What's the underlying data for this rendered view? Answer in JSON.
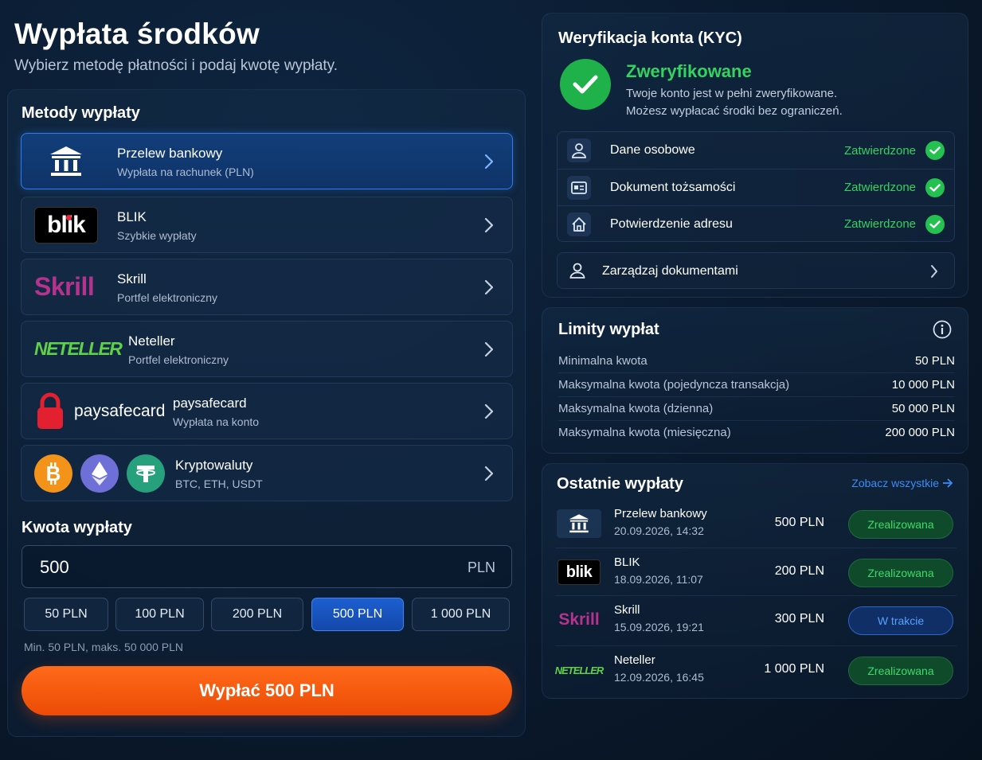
{
  "header": {
    "title": "Wypłata środków",
    "subtitle": "Wybierz metodę płatności i podaj kwotę wypłaty."
  },
  "methods": {
    "title": "Metody wypłaty",
    "items": [
      {
        "name": "Przelew bankowy",
        "desc": "Wypłata na rachunek (PLN)",
        "selected": true,
        "icon": "bank-icon"
      },
      {
        "name": "BLIK",
        "desc": "Szybkie wypłaty",
        "logo_text": "blik"
      },
      {
        "name": "Skrill",
        "desc": "Portfel elektroniczny",
        "logo_text": "Skrill"
      },
      {
        "name": "Neteller",
        "desc": "Portfel elektroniczny",
        "logo_text": "NETELLER"
      },
      {
        "name": "paysafecard",
        "desc": "Wypłata na konto",
        "logo_text": "paysafecard"
      },
      {
        "name": "Kryptowaluty",
        "desc": "BTC, ETH, USDT"
      }
    ]
  },
  "amount": {
    "title": "Kwota wypłaty",
    "value": "500",
    "currency": "PLN",
    "chips": [
      "50 PLN",
      "100 PLN",
      "200 PLN",
      "500 PLN",
      "1 000 PLN"
    ],
    "active_chip": "500 PLN",
    "hint": "Min. 50 PLN, maks. 50 000 PLN",
    "cta": "Wypłać 500 PLN"
  },
  "kyc": {
    "title": "Weryfikacja konta (KYC)",
    "status_title": "Zweryfikowane",
    "status_line1": "Twoje konto jest w pełni zweryfikowane.",
    "status_line2": "Możesz wypłacać środki bez ograniczeń.",
    "items": [
      {
        "label": "Dane osobowe",
        "status": "Zatwierdzone",
        "icon": "user-icon"
      },
      {
        "label": "Dokument tożsamości",
        "status": "Zatwierdzone",
        "icon": "id-card-icon"
      },
      {
        "label": "Potwierdzenie adresu",
        "status": "Zatwierdzone",
        "icon": "home-icon"
      }
    ],
    "manage": "Zarządzaj dokumentami"
  },
  "limits": {
    "title": "Limity wypłat",
    "rows": [
      {
        "label": "Minimalna kwota",
        "value": "50 PLN"
      },
      {
        "label": "Maksymalna kwota (pojedyncza transakcja)",
        "value": "10 000 PLN"
      },
      {
        "label": "Maksymalna kwota (dzienna)",
        "value": "50 000 PLN"
      },
      {
        "label": "Maksymalna kwota (miesięczna)",
        "value": "200 000 PLN"
      }
    ]
  },
  "recent": {
    "title": "Ostatnie wypłaty",
    "see_all": "Zobacz wszystkie",
    "rows": [
      {
        "method": "Przelew bankowy",
        "date": "20.09.2026, 14:32",
        "amount": "500 PLN",
        "status": "Zrealizowana",
        "state": "done",
        "logo_text": ""
      },
      {
        "method": "BLIK",
        "date": "18.09.2026, 11:07",
        "amount": "200 PLN",
        "status": "Zrealizowana",
        "state": "done",
        "logo_text": "blik"
      },
      {
        "method": "Skrill",
        "date": "15.09.2026, 19:21",
        "amount": "300 PLN",
        "status": "W trakcie",
        "state": "pending",
        "logo_text": "Skrill"
      },
      {
        "method": "Neteller",
        "date": "12.09.2026, 16:45",
        "amount": "1 000 PLN",
        "status": "Zrealizowana",
        "state": "done",
        "logo_text": "NETELLER"
      }
    ]
  },
  "colors": {
    "accent_blue": "#2f7ef0",
    "cta_orange": "#ff6a1a",
    "success_green": "#33d35f",
    "pending_blue": "#5aa0ff"
  }
}
